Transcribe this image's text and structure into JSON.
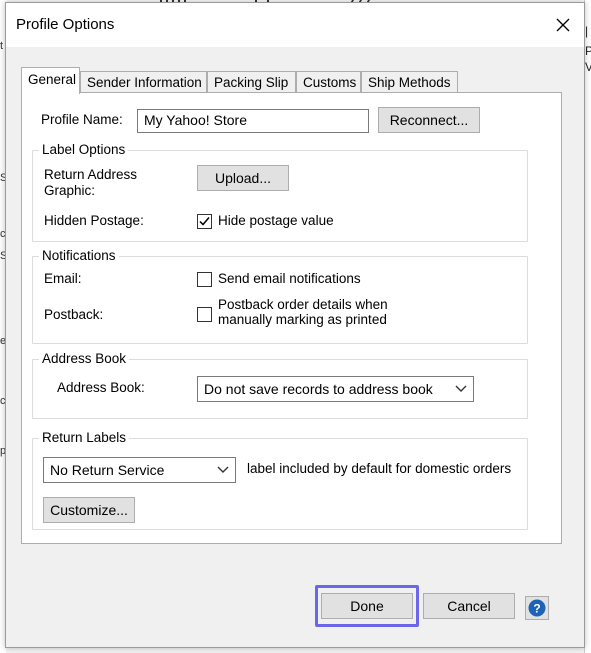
{
  "dialog": {
    "title": "Profile Options",
    "close_icon": "close-icon"
  },
  "tabs": [
    {
      "label": "General",
      "active": true
    },
    {
      "label": "Sender Information",
      "active": false
    },
    {
      "label": "Packing Slip",
      "active": false
    },
    {
      "label": "Customs",
      "active": false
    },
    {
      "label": "Ship Methods",
      "active": false
    }
  ],
  "profile": {
    "name_label": "Profile Name:",
    "name_value": "My Yahoo! Store",
    "reconnect_label": "Reconnect..."
  },
  "label_options": {
    "legend": "Label Options",
    "return_address_label_line1": "Return Address",
    "return_address_label_line2": "Graphic:",
    "upload_label": "Upload...",
    "hidden_postage_label": "Hidden Postage:",
    "hide_postage_checkbox_label": "Hide postage value",
    "hide_postage_checked": true
  },
  "notifications": {
    "legend": "Notifications",
    "email_label": "Email:",
    "email_checkbox_label": "Send email notifications",
    "email_checked": false,
    "postback_label": "Postback:",
    "postback_checkbox_line1": "Postback order details when",
    "postback_checkbox_line2": "manually marking as printed",
    "postback_checked": false
  },
  "address_book": {
    "legend": "Address Book",
    "label": "Address Book:",
    "selected": "Do not save records to address book"
  },
  "return_labels": {
    "legend": "Return Labels",
    "selected": "No Return Service",
    "suffix_text": "label included by default for domestic orders",
    "customize_label": "Customize..."
  },
  "footer": {
    "done_label": "Done",
    "cancel_label": "Cancel",
    "help_icon": "help-icon",
    "focus_color": "#6b67e8"
  },
  "background": {
    "right_chars": [
      "|",
      "P",
      "V"
    ],
    "left_chars": [
      "t",
      "S",
      "c",
      "S",
      "e",
      "c",
      "p"
    ]
  }
}
